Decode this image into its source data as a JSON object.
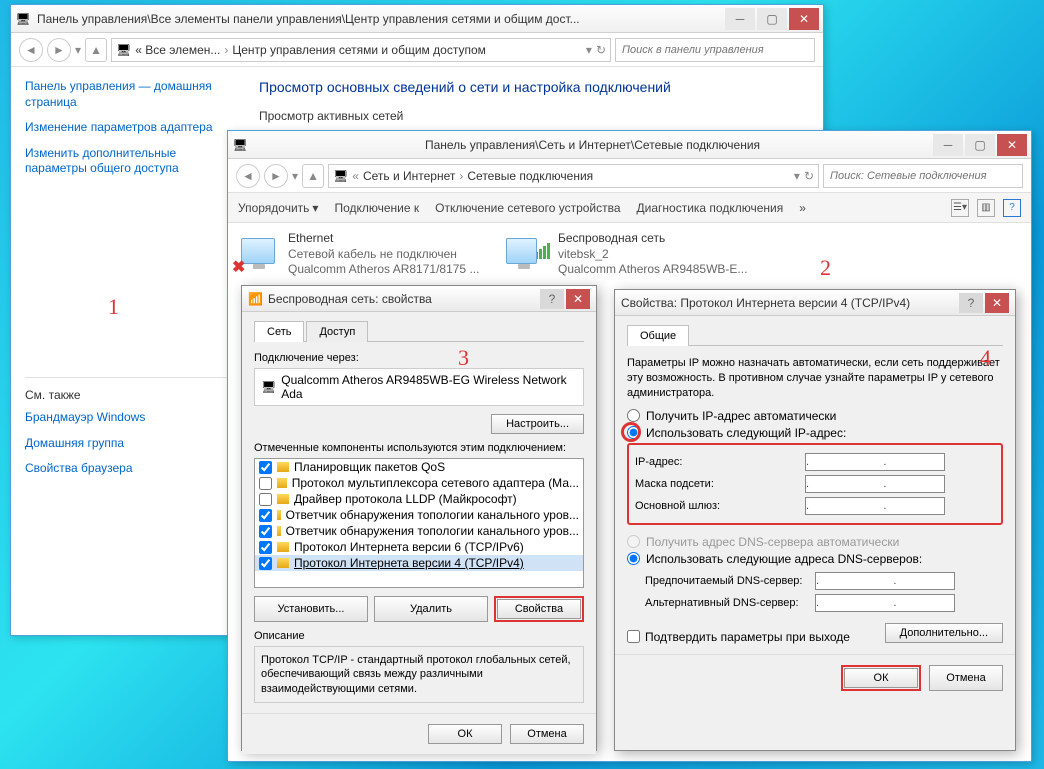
{
  "win1": {
    "title": "Панель управления\\Все элементы панели управления\\Центр управления сетями и общим дост...",
    "breadcrumb_prefix": "« Все элемен...",
    "breadcrumb_current": "Центр управления сетями и общим доступом",
    "search_placeholder": "Поиск в панели управления",
    "sidebar": {
      "home": "Панель управления — домашняя страница",
      "link1": "Изменение параметров адаптера",
      "link2": "Изменить дополнительные параметры общего доступа",
      "see_also": "См. также",
      "fw": "Брандмауэр Windows",
      "hg": "Домашняя группа",
      "bo": "Свойства браузера"
    },
    "heading": "Просмотр основных сведений о сети и настройка подключений",
    "subheading": "Просмотр активных сетей"
  },
  "win2": {
    "title": "Панель управления\\Сеть и Интернет\\Сетевые подключения",
    "bc1": "Сеть и Интернет",
    "bc2": "Сетевые подключения",
    "search_placeholder": "Поиск: Сетевые подключения",
    "toolbar": {
      "organize": "Упорядочить",
      "connect": "Подключение к",
      "disable": "Отключение сетевого устройства",
      "diag": "Диагностика подключения"
    },
    "ethernet": {
      "name": "Ethernet",
      "status": "Сетевой кабель не подключен",
      "adapter": "Qualcomm Atheros AR8171/8175 ..."
    },
    "wifi": {
      "name": "Беспроводная сеть",
      "status": "vitebsk_2",
      "adapter": "Qualcomm Atheros AR9485WB-E..."
    }
  },
  "dlg3": {
    "title": "Беспроводная сеть: свойства",
    "tab_net": "Сеть",
    "tab_access": "Доступ",
    "conn_through": "Подключение через:",
    "adapter": "Qualcomm Atheros AR9485WB-EG Wireless Network Ada",
    "configure": "Настроить...",
    "components_label": "Отмеченные компоненты используются этим подключением:",
    "components": [
      {
        "checked": true,
        "label": "Планировщик пакетов QoS"
      },
      {
        "checked": false,
        "label": "Протокол мультиплексора сетевого адаптера (Ма..."
      },
      {
        "checked": false,
        "label": "Драйвер протокола LLDP (Майкрософт)"
      },
      {
        "checked": true,
        "label": "Ответчик обнаружения топологии канального уров..."
      },
      {
        "checked": true,
        "label": "Ответчик обнаружения топологии канального уров..."
      },
      {
        "checked": true,
        "label": "Протокол Интернета версии 6 (TCP/IPv6)"
      },
      {
        "checked": true,
        "label": "Протокол Интернета версии 4 (TCP/IPv4)"
      }
    ],
    "install": "Установить...",
    "remove": "Удалить",
    "properties": "Свойства",
    "desc_heading": "Описание",
    "desc_text": "Протокол TCP/IP - стандартный протокол глобальных сетей, обеспечивающий связь между различными взаимодействующими сетями.",
    "ok": "ОК",
    "cancel": "Отмена"
  },
  "dlg4": {
    "title": "Свойства: Протокол Интернета версии 4 (TCP/IPv4)",
    "tab_general": "Общие",
    "info": "Параметры IP можно назначать автоматически, если сеть поддерживает эту возможность. В противном случае узнайте параметры IP у сетевого администратора.",
    "r_auto_ip": "Получить IP-адрес автоматически",
    "r_manual_ip": "Использовать следующий IP-адрес:",
    "ip_label": "IP-адрес:",
    "mask_label": "Маска подсети:",
    "gw_label": "Основной шлюз:",
    "r_auto_dns": "Получить адрес DNS-сервера автоматически",
    "r_manual_dns": "Использовать следующие адреса DNS-серверов:",
    "dns1_label": "Предпочитаемый DNS-сервер:",
    "dns2_label": "Альтернативный DNS-сервер:",
    "confirm_exit": "Подтвердить параметры при выходе",
    "advanced": "Дополнительно...",
    "ok": "ОК",
    "cancel": "Отмена",
    "dots": ".      .      ."
  }
}
